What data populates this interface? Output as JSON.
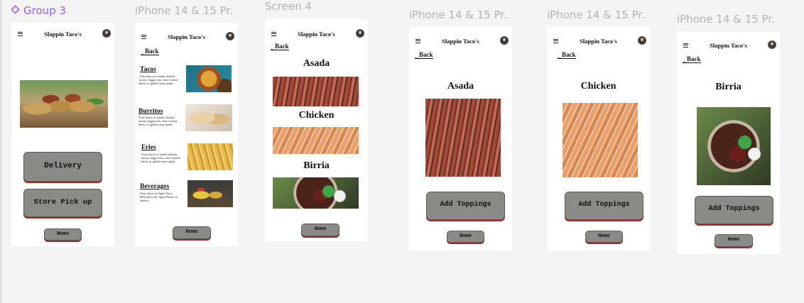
{
  "frames": [
    {
      "label": "Group 3",
      "is_group": true
    },
    {
      "label": "iPhone 14 & 15 Pr..."
    },
    {
      "label": "Screen 4"
    },
    {
      "label": "iPhone 14 & 15 Pr..."
    },
    {
      "label": "iPhone 14 & 15 Pr..."
    },
    {
      "label": "iPhone 14 & 15 Pr..."
    }
  ],
  "app": {
    "brand": "Slappin Taco's",
    "back": "Back",
    "home": "Home"
  },
  "screen1": {
    "delivery": "Delivery",
    "pickup": "Store Pick up"
  },
  "screen2": {
    "items": [
      {
        "name": "Tacos",
        "desc": "Your choice of tender chicken, savory veggie mix, slow-cooked birria, or grilled carne asada."
      },
      {
        "name": "Burritos",
        "desc": "Your choice of tender chicken, savory veggie mix, slow-cooked birria, or grilled carne asada."
      },
      {
        "name": "Fries",
        "desc": "Your choice of tender chicken, savory veggie mix, slow-cooked birria, or grilled carne asada."
      },
      {
        "name": "Beverages",
        "desc": "Your choice of Topo Chico, Mexican Coke, Agua Fresca, or Jarritos"
      }
    ]
  },
  "screen3": {
    "dishes": [
      "Asada",
      "Chicken",
      "Birria"
    ]
  },
  "detail_screens": [
    {
      "title": "Asada",
      "button": "Add Toppings"
    },
    {
      "title": "Chicken",
      "button": "Add Toppings"
    },
    {
      "title": "Birria",
      "button": "Add Toppings"
    }
  ]
}
